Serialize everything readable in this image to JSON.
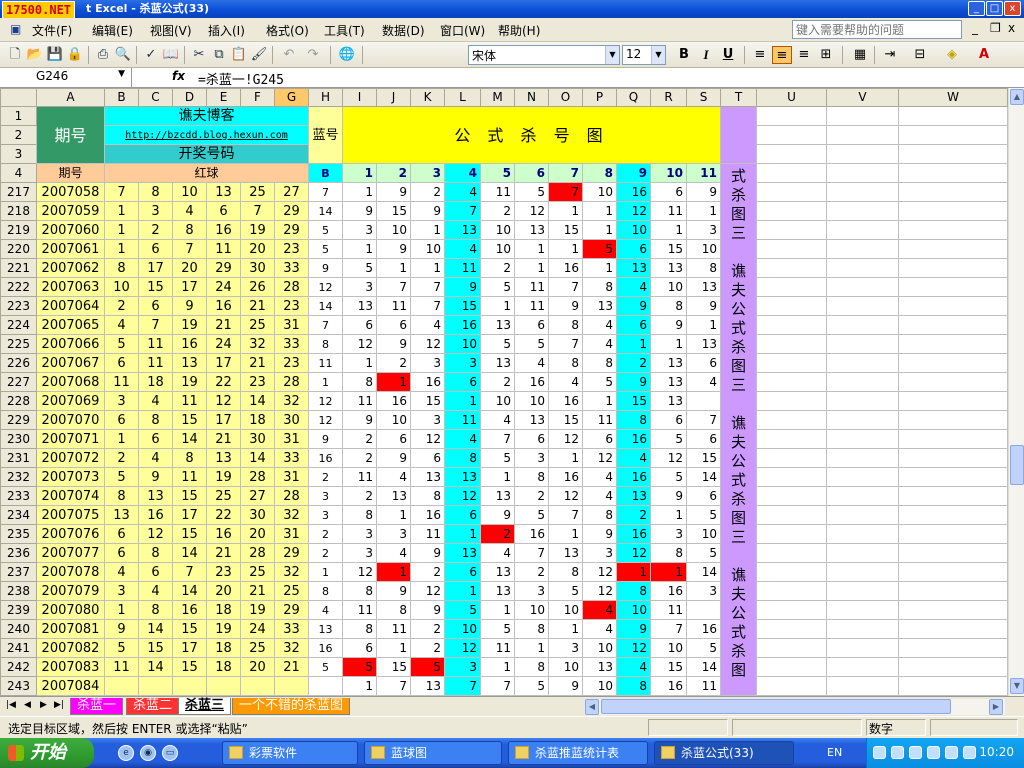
{
  "window": {
    "logo": "17500.NET",
    "title": "t Excel - 杀蓝公式(33)",
    "min": "_",
    "max": "□",
    "close": "x"
  },
  "menu": {
    "items": [
      "文件(F)",
      "编辑(E)",
      "视图(V)",
      "插入(I)",
      "格式(O)",
      "工具(T)",
      "数据(D)",
      "窗口(W)",
      "帮助(H)"
    ],
    "help_placeholder": "键入需要帮助的问题",
    "doc_min": "_",
    "doc_restore": "❐",
    "doc_close": "x"
  },
  "toolbar": {
    "font": "宋体",
    "size": "12",
    "bold": "B",
    "italic": "I",
    "underline": "U"
  },
  "formula_bar": {
    "name_box": "G246",
    "fx": "fx",
    "formula": "=杀蓝一!G245"
  },
  "columns": [
    "A",
    "B",
    "C",
    "D",
    "E",
    "F",
    "G",
    "H",
    "I",
    "J",
    "K",
    "L",
    "M",
    "N",
    "O",
    "P",
    "Q",
    "R",
    "S",
    "T",
    "U",
    "V",
    "W"
  ],
  "header": {
    "period": "期号",
    "blog": "谯夫博客",
    "url": "http://bzcdd.blog.hexun.com",
    "draw_numbers": "开奖号码",
    "blue_num": "蓝号",
    "formula_title": "公 式 杀 号 图",
    "period2": "期号",
    "red_balls": "红球",
    "b_label": "B",
    "formula_cols": [
      "1",
      "2",
      "3",
      "4",
      "5",
      "6",
      "7",
      "8",
      "9",
      "10",
      "11"
    ]
  },
  "header_rows": [
    "1",
    "2",
    "3",
    "4"
  ],
  "vertical_text": [
    "式",
    "杀",
    "图",
    "三",
    "",
    "谯",
    "夫",
    "公",
    "式",
    "杀",
    "图",
    "三",
    "",
    "谯",
    "夫",
    "公",
    "式",
    "杀",
    "图",
    "三",
    "",
    "谯",
    "夫",
    "公",
    "式",
    "杀",
    "图"
  ],
  "rows": [
    {
      "row": "217",
      "period": "2007058",
      "red": [
        "7",
        "8",
        "10",
        "13",
        "25",
        "27"
      ],
      "blue": "7",
      "f": [
        "1",
        "9",
        "2",
        "4",
        "11",
        "5",
        "7",
        "10",
        "16",
        "6",
        "9"
      ]
    },
    {
      "row": "218",
      "period": "2007059",
      "red": [
        "1",
        "3",
        "4",
        "6",
        "7",
        "29"
      ],
      "blue": "14",
      "f": [
        "9",
        "15",
        "9",
        "7",
        "2",
        "12",
        "1",
        "1",
        "12",
        "11",
        "1"
      ]
    },
    {
      "row": "219",
      "period": "2007060",
      "red": [
        "1",
        "2",
        "8",
        "16",
        "19",
        "29"
      ],
      "blue": "5",
      "f": [
        "3",
        "10",
        "1",
        "13",
        "10",
        "13",
        "15",
        "1",
        "10",
        "1",
        "3"
      ]
    },
    {
      "row": "220",
      "period": "2007061",
      "red": [
        "1",
        "6",
        "7",
        "11",
        "20",
        "23"
      ],
      "blue": "5",
      "f": [
        "1",
        "9",
        "10",
        "4",
        "10",
        "1",
        "1",
        "5",
        "6",
        "15",
        "10"
      ]
    },
    {
      "row": "221",
      "period": "2007062",
      "red": [
        "8",
        "17",
        "20",
        "29",
        "30",
        "33"
      ],
      "blue": "9",
      "f": [
        "5",
        "1",
        "1",
        "11",
        "2",
        "1",
        "16",
        "1",
        "13",
        "13",
        "8"
      ]
    },
    {
      "row": "222",
      "period": "2007063",
      "red": [
        "10",
        "15",
        "17",
        "24",
        "26",
        "28"
      ],
      "blue": "12",
      "f": [
        "3",
        "7",
        "7",
        "9",
        "5",
        "11",
        "7",
        "8",
        "4",
        "10",
        "13"
      ]
    },
    {
      "row": "223",
      "period": "2007064",
      "red": [
        "2",
        "6",
        "9",
        "16",
        "21",
        "23"
      ],
      "blue": "14",
      "f": [
        "13",
        "11",
        "7",
        "15",
        "1",
        "11",
        "9",
        "13",
        "9",
        "8",
        "9"
      ]
    },
    {
      "row": "224",
      "period": "2007065",
      "red": [
        "4",
        "7",
        "19",
        "21",
        "25",
        "31"
      ],
      "blue": "7",
      "f": [
        "6",
        "6",
        "4",
        "16",
        "13",
        "6",
        "8",
        "4",
        "6",
        "9",
        "1"
      ]
    },
    {
      "row": "225",
      "period": "2007066",
      "red": [
        "5",
        "11",
        "16",
        "24",
        "32",
        "33"
      ],
      "blue": "8",
      "f": [
        "12",
        "9",
        "12",
        "10",
        "5",
        "5",
        "7",
        "4",
        "1",
        "1",
        "13"
      ]
    },
    {
      "row": "226",
      "period": "2007067",
      "red": [
        "6",
        "11",
        "13",
        "17",
        "21",
        "23"
      ],
      "blue": "11",
      "f": [
        "1",
        "2",
        "3",
        "3",
        "13",
        "4",
        "8",
        "8",
        "2",
        "13",
        "6"
      ]
    },
    {
      "row": "227",
      "period": "2007068",
      "red": [
        "11",
        "18",
        "19",
        "22",
        "23",
        "28"
      ],
      "blue": "1",
      "f": [
        "8",
        "1",
        "16",
        "6",
        "2",
        "16",
        "4",
        "5",
        "9",
        "13",
        "4"
      ]
    },
    {
      "row": "228",
      "period": "2007069",
      "red": [
        "3",
        "4",
        "11",
        "12",
        "14",
        "32"
      ],
      "blue": "12",
      "f": [
        "11",
        "16",
        "15",
        "1",
        "10",
        "10",
        "16",
        "1",
        "15",
        "13",
        ""
      ]
    },
    {
      "row": "229",
      "period": "2007070",
      "red": [
        "6",
        "8",
        "15",
        "17",
        "18",
        "30"
      ],
      "blue": "12",
      "f": [
        "9",
        "10",
        "3",
        "11",
        "4",
        "13",
        "15",
        "11",
        "8",
        "6",
        "7"
      ]
    },
    {
      "row": "230",
      "period": "2007071",
      "red": [
        "1",
        "6",
        "14",
        "21",
        "30",
        "31"
      ],
      "blue": "9",
      "f": [
        "2",
        "6",
        "12",
        "4",
        "7",
        "6",
        "12",
        "6",
        "16",
        "5",
        "6"
      ]
    },
    {
      "row": "231",
      "period": "2007072",
      "red": [
        "2",
        "4",
        "8",
        "13",
        "14",
        "33"
      ],
      "blue": "16",
      "f": [
        "2",
        "9",
        "6",
        "8",
        "5",
        "3",
        "1",
        "12",
        "4",
        "12",
        "15"
      ]
    },
    {
      "row": "232",
      "period": "2007073",
      "red": [
        "5",
        "9",
        "11",
        "19",
        "28",
        "31"
      ],
      "blue": "2",
      "f": [
        "11",
        "4",
        "13",
        "13",
        "1",
        "8",
        "16",
        "4",
        "16",
        "5",
        "14"
      ]
    },
    {
      "row": "233",
      "period": "2007074",
      "red": [
        "8",
        "13",
        "15",
        "25",
        "27",
        "28"
      ],
      "blue": "3",
      "f": [
        "2",
        "13",
        "8",
        "12",
        "13",
        "2",
        "12",
        "4",
        "13",
        "9",
        "6"
      ]
    },
    {
      "row": "234",
      "period": "2007075",
      "red": [
        "13",
        "16",
        "17",
        "22",
        "30",
        "32"
      ],
      "blue": "3",
      "f": [
        "8",
        "1",
        "16",
        "6",
        "9",
        "5",
        "7",
        "8",
        "2",
        "1",
        "5"
      ]
    },
    {
      "row": "235",
      "period": "2007076",
      "red": [
        "6",
        "12",
        "15",
        "16",
        "20",
        "31"
      ],
      "blue": "2",
      "f": [
        "3",
        "3",
        "11",
        "1",
        "2",
        "16",
        "1",
        "9",
        "16",
        "3",
        "10"
      ]
    },
    {
      "row": "236",
      "period": "2007077",
      "red": [
        "6",
        "8",
        "14",
        "21",
        "28",
        "29"
      ],
      "blue": "2",
      "f": [
        "3",
        "4",
        "9",
        "13",
        "4",
        "7",
        "13",
        "3",
        "12",
        "8",
        "5"
      ]
    },
    {
      "row": "237",
      "period": "2007078",
      "red": [
        "4",
        "6",
        "7",
        "23",
        "25",
        "32"
      ],
      "blue": "1",
      "f": [
        "12",
        "1",
        "2",
        "6",
        "13",
        "2",
        "8",
        "12",
        "1",
        "1",
        "14"
      ]
    },
    {
      "row": "238",
      "period": "2007079",
      "red": [
        "3",
        "4",
        "14",
        "20",
        "21",
        "25"
      ],
      "blue": "8",
      "f": [
        "8",
        "9",
        "12",
        "1",
        "13",
        "3",
        "5",
        "12",
        "8",
        "16",
        "3"
      ]
    },
    {
      "row": "239",
      "period": "2007080",
      "red": [
        "1",
        "8",
        "16",
        "18",
        "19",
        "29"
      ],
      "blue": "4",
      "f": [
        "11",
        "8",
        "9",
        "5",
        "1",
        "10",
        "10",
        "4",
        "10",
        "11",
        ""
      ]
    },
    {
      "row": "240",
      "period": "2007081",
      "red": [
        "9",
        "14",
        "15",
        "19",
        "24",
        "33"
      ],
      "blue": "13",
      "f": [
        "8",
        "11",
        "2",
        "10",
        "5",
        "8",
        "1",
        "4",
        "9",
        "7",
        "16"
      ]
    },
    {
      "row": "241",
      "period": "2007082",
      "red": [
        "5",
        "15",
        "17",
        "18",
        "25",
        "32"
      ],
      "blue": "16",
      "f": [
        "6",
        "1",
        "2",
        "12",
        "11",
        "1",
        "3",
        "10",
        "12",
        "10",
        "5"
      ]
    },
    {
      "row": "242",
      "period": "2007083",
      "red": [
        "11",
        "14",
        "15",
        "18",
        "20",
        "21"
      ],
      "blue": "5",
      "f": [
        "5",
        "15",
        "5",
        "3",
        "1",
        "8",
        "10",
        "13",
        "4",
        "15",
        "14"
      ]
    },
    {
      "row": "243",
      "period": "2007084",
      "red": [
        "",
        "",
        "",
        "",
        "",
        ""
      ],
      "blue": "",
      "f": [
        "1",
        "7",
        "13",
        "7",
        "7",
        "5",
        "9",
        "10",
        "8",
        "16",
        "11"
      ]
    }
  ],
  "sheets": [
    "杀蓝一",
    "杀蓝二",
    "杀蓝三",
    "一个不错的杀蓝图"
  ],
  "sheet_colors": [
    "#ff00ff",
    "#ff3333",
    "#ffffff",
    "#ff9900"
  ],
  "status": {
    "message": "选定目标区域，然后按 ENTER 或选择“粘贴”",
    "mode": "数字"
  },
  "taskbar": {
    "start": "开始",
    "tasks": [
      "彩票软件",
      "蓝球图",
      "杀蓝推蓝统计表",
      "杀蓝公式(33)"
    ],
    "lang": "EN",
    "clock": "10:20"
  }
}
